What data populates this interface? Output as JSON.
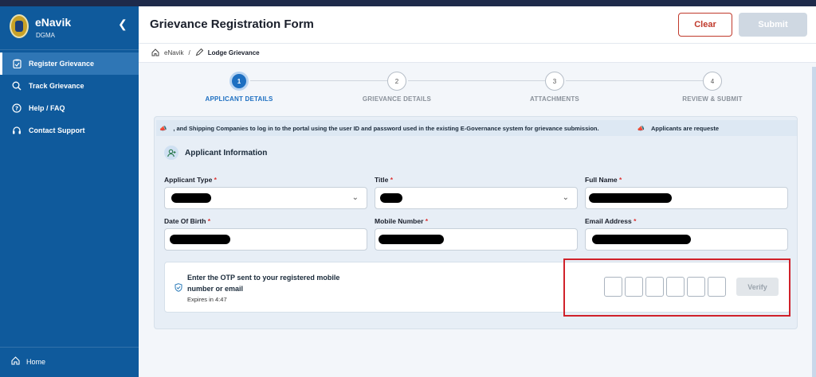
{
  "app": {
    "name": "eNavik",
    "subtitle": "DGMA"
  },
  "sidebar": {
    "items": [
      {
        "label": "Register Grievance",
        "icon": "clipboard-icon",
        "active": true
      },
      {
        "label": "Track Grievance",
        "icon": "search-icon",
        "active": false
      },
      {
        "label": "Help / FAQ",
        "icon": "help-icon",
        "active": false
      },
      {
        "label": "Contact Support",
        "icon": "headset-icon",
        "active": false
      }
    ],
    "home_label": "Home"
  },
  "header": {
    "title": "Grievance Registration Form",
    "clear_label": "Clear",
    "submit_label": "Submit"
  },
  "breadcrumb": {
    "root": "eNavik",
    "separator": "/",
    "current": "Lodge Grievance"
  },
  "stepper": {
    "steps": [
      {
        "number": "1",
        "label": "APPLICANT DETAILS",
        "active": true
      },
      {
        "number": "2",
        "label": "GRIEVANCE DETAILS",
        "active": false
      },
      {
        "number": "3",
        "label": "ATTACHMENTS",
        "active": false
      },
      {
        "number": "4",
        "label": "REVIEW & SUBMIT",
        "active": false
      }
    ]
  },
  "ticker": {
    "text1": ", and Shipping Companies to log in to the portal using the user ID and password used in the existing E-Governance system for grievance submission.",
    "text2": "Applicants are requeste"
  },
  "form": {
    "section_title": "Applicant Information",
    "required_mark": "*",
    "fields": {
      "applicant_type": "Applicant Type",
      "title": "Title",
      "full_name": "Full Name",
      "dob": "Date Of Birth",
      "mobile": "Mobile Number",
      "email": "Email Address"
    }
  },
  "otp": {
    "message": "Enter the OTP sent to your registered mobile number or email",
    "expires": "Expires in 4:47",
    "verify_label": "Verify",
    "digits": 6
  },
  "colors": {
    "sidebar": "#0f5a9c",
    "accent": "#1d6fc1",
    "danger": "#c0392b"
  }
}
